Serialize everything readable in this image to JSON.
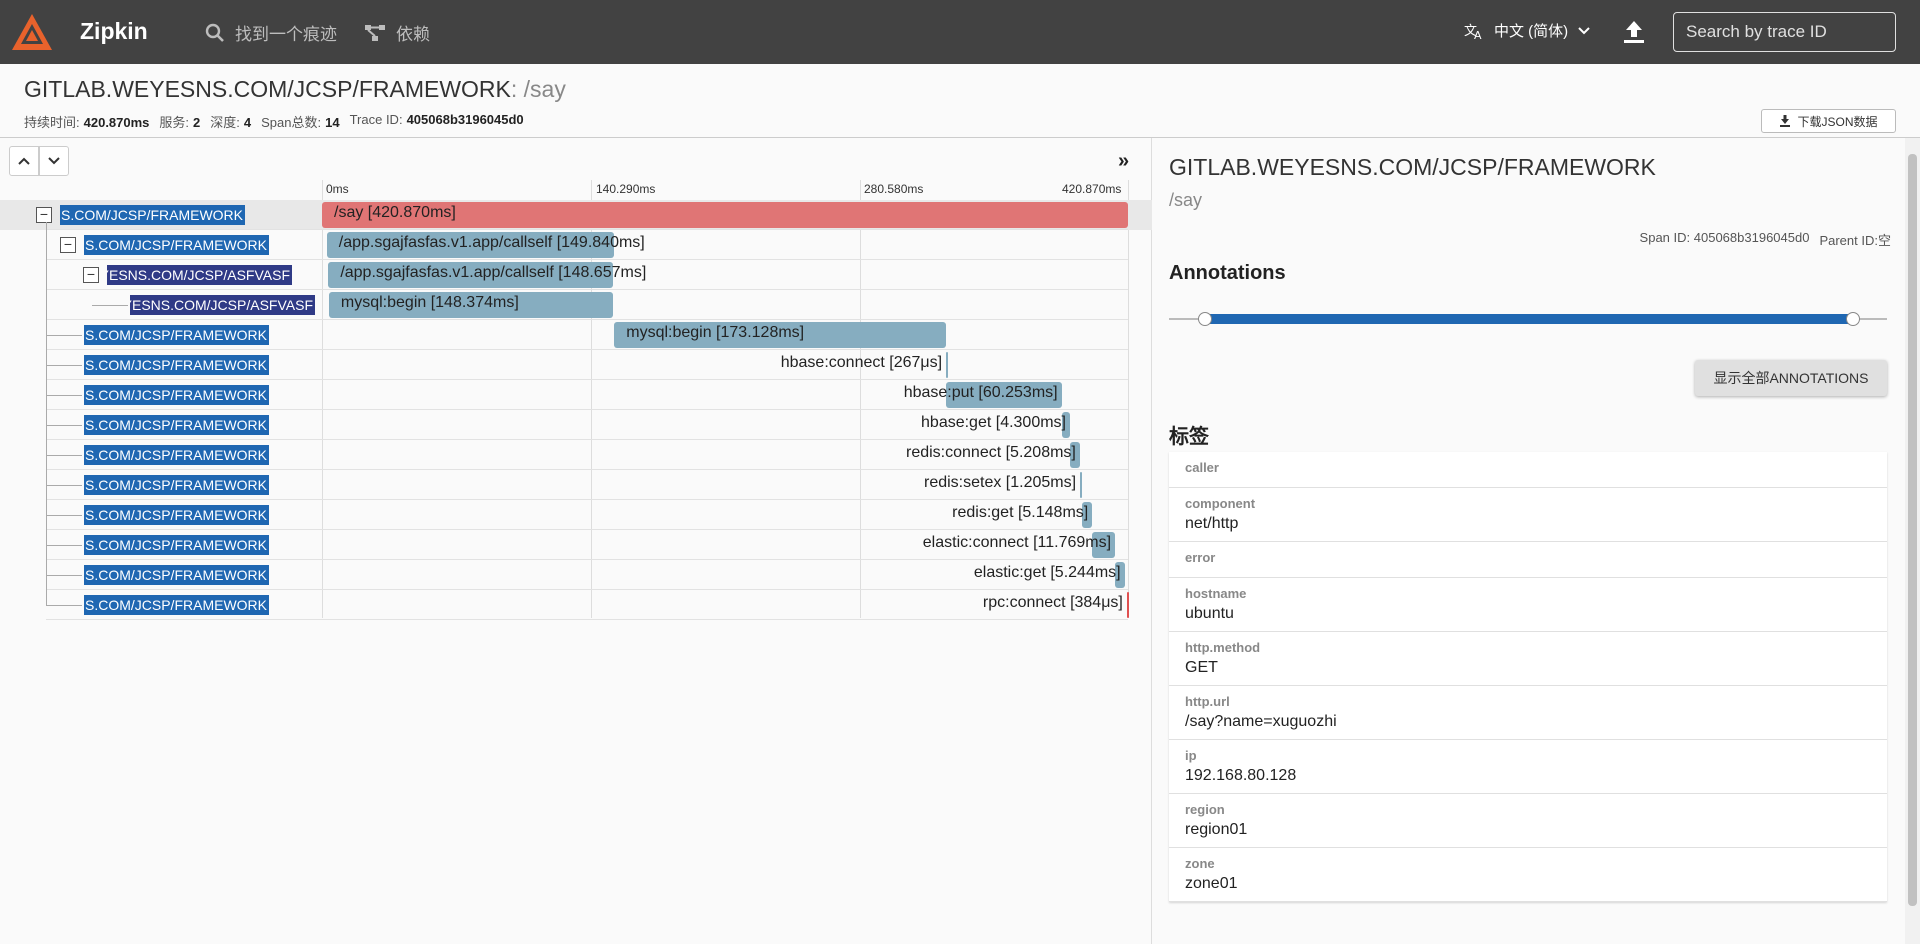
{
  "app": {
    "brand": "Zipkin",
    "nav_find": "找到一个痕迹",
    "nav_deps": "依赖",
    "language": "中文 (简体)",
    "search_placeholder": "Search by trace ID"
  },
  "trace": {
    "service": "GITLAB.WEYESNS.COM/JCSP/FRAMEWORK",
    "separator": ":",
    "operation": "/say",
    "stats": [
      {
        "label": "持续时间:",
        "value": "420.870ms"
      },
      {
        "label": "服务:",
        "value": "2"
      },
      {
        "label": "深度:",
        "value": "4"
      },
      {
        "label": "Span总数:",
        "value": "14"
      },
      {
        "label": "Trace ID:",
        "value": "405068b3196045d0"
      }
    ],
    "download_json": "下载JSON数据"
  },
  "timeline": {
    "ticks": [
      "0ms",
      "140.290ms",
      "280.580ms",
      "420.870ms"
    ],
    "total_ms": 420.87,
    "spans": [
      {
        "service": "GITLAB.WEYESNS.COM/JCSP/FRAMEWORK",
        "depth": 0,
        "name": "/say [420.870ms]",
        "start_ms": 0,
        "duration_ms": 420.87,
        "color": "#e07575",
        "toggle": true
      },
      {
        "service": "GITLAB.WEYESNS.COM/JCSP/FRAMEWORK",
        "depth": 1,
        "name": "/app.sgajfasfas.v1.app/callself [149.840ms]",
        "start_ms": 2.5,
        "duration_ms": 149.84,
        "color": "#86adc0",
        "toggle": true
      },
      {
        "service": "GITLAB.WEYESNS.COM/JCSP/ASFVASF",
        "depth": 2,
        "name": "/app.sgajfasfas.v1.app/callself [148.657ms]",
        "start_ms": 3.3,
        "duration_ms": 148.657,
        "color": "#86adc0",
        "toggle": true
      },
      {
        "service": "GITLAB.WEYESNS.COM/JCSP/ASFVASF",
        "depth": 3,
        "name": "mysql:begin [148.374ms]",
        "start_ms": 3.6,
        "duration_ms": 148.374,
        "color": "#86adc0",
        "toggle": false
      },
      {
        "service": "GITLAB.WEYESNS.COM/JCSP/FRAMEWORK",
        "depth": 1,
        "name": "mysql:begin [173.128ms]",
        "start_ms": 152.6,
        "duration_ms": 173.128,
        "color": "#86adc0",
        "toggle": false
      },
      {
        "service": "GITLAB.WEYESNS.COM/JCSP/FRAMEWORK",
        "depth": 1,
        "name": "hbase:connect [267μs]",
        "start_ms": 325.7,
        "duration_ms": 0.267,
        "color": "#86adc0",
        "toggle": false
      },
      {
        "service": "GITLAB.WEYESNS.COM/JCSP/FRAMEWORK",
        "depth": 1,
        "name": "hbase:put [60.253ms]",
        "start_ms": 326.0,
        "duration_ms": 60.253,
        "color": "#86adc0",
        "toggle": false
      },
      {
        "service": "GITLAB.WEYESNS.COM/JCSP/FRAMEWORK",
        "depth": 1,
        "name": "hbase:get [4.300ms]",
        "start_ms": 386.3,
        "duration_ms": 4.3,
        "color": "#86adc0",
        "toggle": false
      },
      {
        "service": "GITLAB.WEYESNS.COM/JCSP/FRAMEWORK",
        "depth": 1,
        "name": "redis:connect [5.208ms]",
        "start_ms": 390.6,
        "duration_ms": 5.208,
        "color": "#86adc0",
        "toggle": false
      },
      {
        "service": "GITLAB.WEYESNS.COM/JCSP/FRAMEWORK",
        "depth": 1,
        "name": "redis:setex [1.205ms]",
        "start_ms": 395.8,
        "duration_ms": 1.205,
        "color": "#86adc0",
        "toggle": false
      },
      {
        "service": "GITLAB.WEYESNS.COM/JCSP/FRAMEWORK",
        "depth": 1,
        "name": "redis:get [5.148ms]",
        "start_ms": 397.0,
        "duration_ms": 5.148,
        "color": "#86adc0",
        "toggle": false
      },
      {
        "service": "GITLAB.WEYESNS.COM/JCSP/FRAMEWORK",
        "depth": 1,
        "name": "elastic:connect [11.769ms]",
        "start_ms": 402.2,
        "duration_ms": 11.769,
        "color": "#86adc0",
        "toggle": false
      },
      {
        "service": "GITLAB.WEYESNS.COM/JCSP/FRAMEWORK",
        "depth": 1,
        "name": "elastic:get [5.244ms]",
        "start_ms": 414.0,
        "duration_ms": 5.244,
        "color": "#86adc0",
        "toggle": false
      },
      {
        "service": "GITLAB.WEYESNS.COM/JCSP/FRAMEWORK",
        "depth": 1,
        "name": "rpc:connect [384μs]",
        "start_ms": 420.3,
        "duration_ms": 0.384,
        "color": "#e05050",
        "toggle": false
      }
    ]
  },
  "detail": {
    "service": "GITLAB.WEYESNS.COM/JCSP/FRAMEWORK",
    "operation": "/say",
    "span_id_label": "Span ID:",
    "span_id": "405068b3196045d0",
    "parent_id_label": "Parent ID:",
    "parent_id": "空",
    "annotations_heading": "Annotations",
    "show_annotations": "显示全部ANNOTATIONS",
    "tags_heading": "标签",
    "tags": [
      {
        "key": "caller",
        "value": ""
      },
      {
        "key": "component",
        "value": "net/http"
      },
      {
        "key": "error",
        "value": ""
      },
      {
        "key": "hostname",
        "value": "ubuntu"
      },
      {
        "key": "http.method",
        "value": "GET"
      },
      {
        "key": "http.url",
        "value": "/say?name=xuguozhi"
      },
      {
        "key": "ip",
        "value": "192.168.80.128"
      },
      {
        "key": "region",
        "value": "region01"
      },
      {
        "key": "zone",
        "value": "zone01"
      }
    ]
  }
}
